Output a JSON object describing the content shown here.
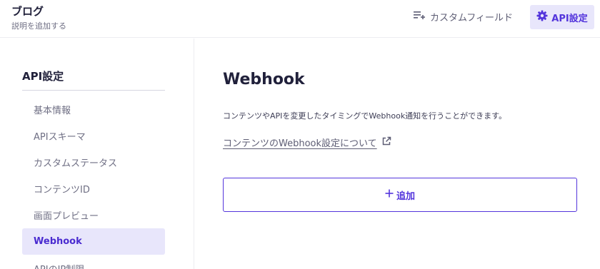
{
  "header": {
    "title": "ブログ",
    "description": "説明を追加する",
    "custom_field_label": "カスタムフィールド",
    "api_settings_label": "API設定"
  },
  "sidebar": {
    "heading": "API設定",
    "items": [
      {
        "label": "基本情報",
        "active": false
      },
      {
        "label": "APIスキーマ",
        "active": false
      },
      {
        "label": "カスタムステータス",
        "active": false
      },
      {
        "label": "コンテンツID",
        "active": false
      },
      {
        "label": "画面プレビュー",
        "active": false
      },
      {
        "label": "Webhook",
        "active": true
      },
      {
        "label": "APIのIP制限",
        "active": false
      }
    ]
  },
  "main": {
    "title": "Webhook",
    "description": "コンテンツやAPIを変更したタイミングでWebhook通知を行うことができます。",
    "help_link": "コンテンツのWebhook設定について",
    "add_button": "追加"
  },
  "colors": {
    "accent": "#5335dc",
    "accent_bg": "#e8e6fb"
  }
}
